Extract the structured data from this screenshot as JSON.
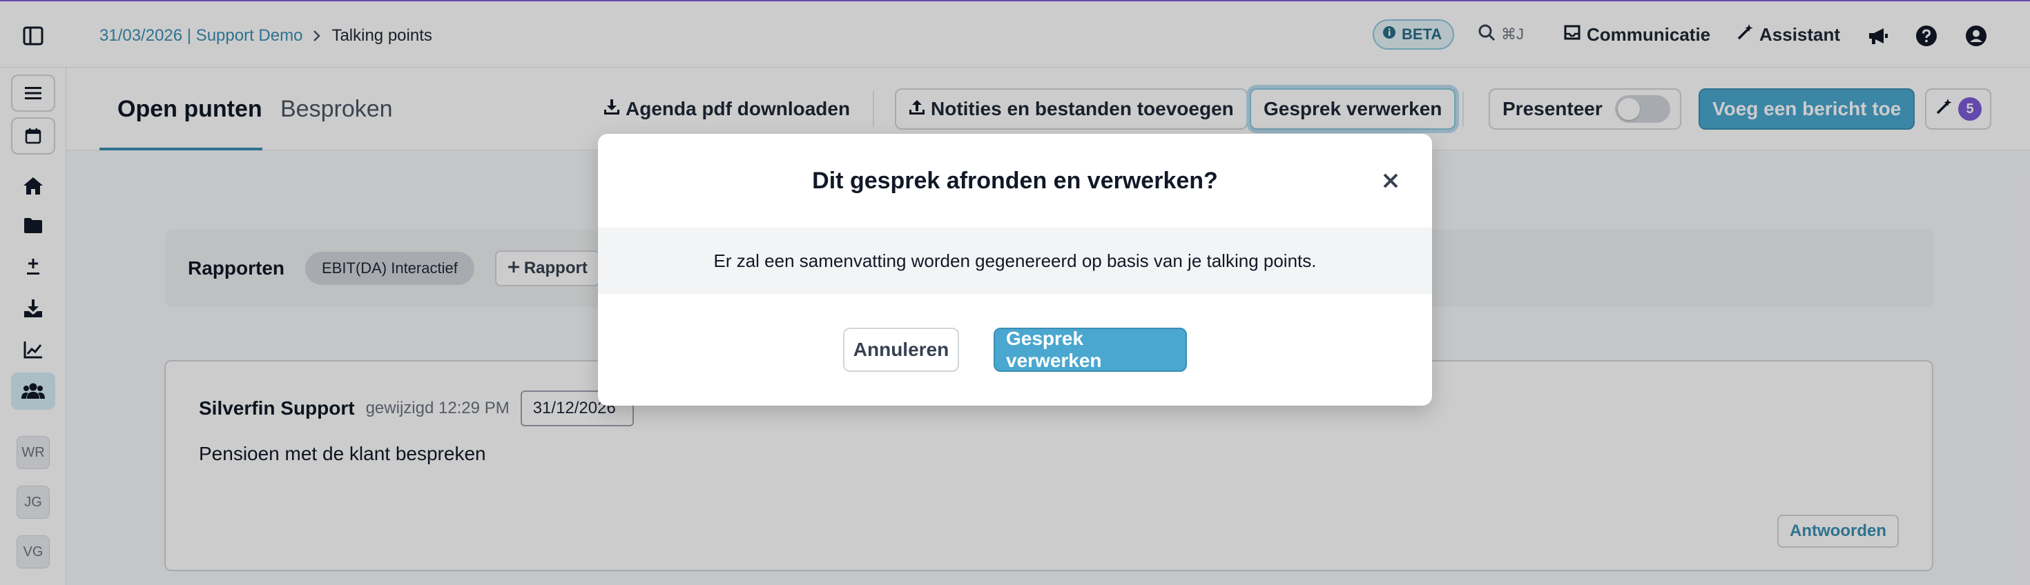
{
  "topbar": {
    "breadcrumb": {
      "link": "31/03/2026 | Support Demo",
      "current": "Talking points"
    },
    "beta": "BETA",
    "search_shortcut": "⌘J",
    "communicatie": "Communicatie",
    "assistant": "Assistant"
  },
  "sidebar": {
    "avatars": [
      "WR",
      "JG",
      "VG"
    ],
    "icons": [
      "menu-icon",
      "calendar-icon",
      "home-icon",
      "folder-icon",
      "plus-minus-icon",
      "download-icon",
      "chart-icon",
      "users-icon"
    ]
  },
  "tabs": {
    "open": "Open punten",
    "besproken": "Besproken"
  },
  "toolbar": {
    "agenda": "Agenda pdf downloaden",
    "notities": "Notities en bestanden toevoegen",
    "gesprek": "Gesprek verwerken",
    "presenteer": "Presenteer",
    "bericht": "Voeg een bericht toe",
    "magic_count": "5"
  },
  "reports": {
    "title": "Rapporten",
    "chip": "EBIT(DA) Interactief",
    "add": "Rapport"
  },
  "card": {
    "author": "Silverfin Support",
    "edited": "gewijzigd 12:29 PM",
    "date": "31/12/2026",
    "body": "Pensioen met de klant bespreken",
    "reply": "Antwoorden"
  },
  "modal": {
    "title": "Dit gesprek afronden en verwerken?",
    "body": "Er zal een samenvatting worden gegenereerd op basis van je talking points.",
    "cancel": "Annuleren",
    "confirm": "Gesprek verwerken"
  },
  "colors": {
    "accent": "#4aa7cf",
    "link": "#3b8fb3",
    "badge": "#7c5cd6"
  }
}
